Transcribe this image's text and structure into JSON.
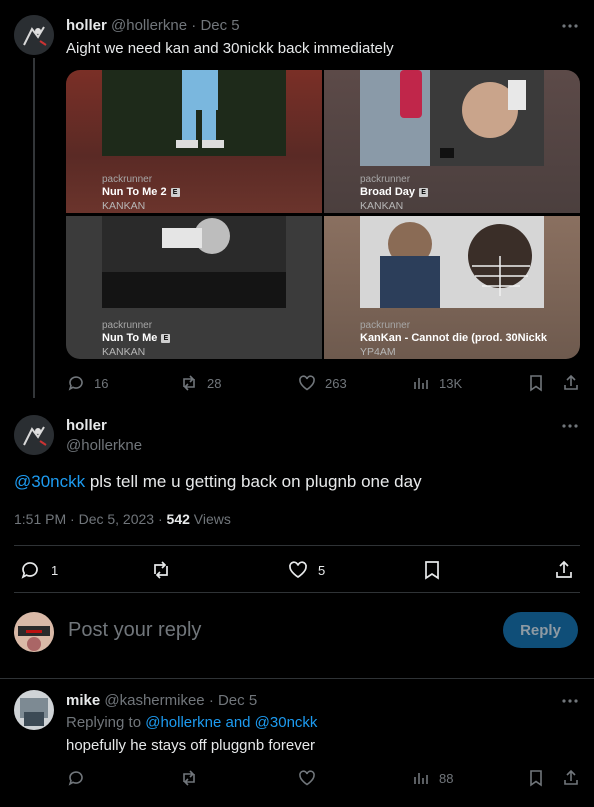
{
  "tweet1": {
    "name": "holler",
    "handle": "@hollerkne",
    "date": "· Dec 5",
    "text": "Aight we need kan and 30nickk back immediately",
    "tiles": [
      {
        "label": "packrunner",
        "title": "Nun To Me 2",
        "artist": "KANKAN"
      },
      {
        "label": "packrunner",
        "title": "Broad Day",
        "artist": "KANKAN"
      },
      {
        "label": "packrunner",
        "title": "Nun To Me",
        "artist": "KANKAN"
      },
      {
        "label": "packrunner",
        "title": "KanKan - Cannot die (prod. 30Nickk",
        "artist": "YP4AM"
      }
    ],
    "stats": {
      "replies": "16",
      "reposts": "28",
      "likes": "263",
      "views": "13K"
    }
  },
  "tweet2": {
    "name": "holler",
    "handle": "@hollerkne",
    "mention": "@30nckk",
    "text": " pls tell me u getting back on plugnb one day",
    "time": "1:51 PM · Dec 5, 2023 · ",
    "views_count": "542",
    "views_label": " Views",
    "stats": {
      "replies": "1",
      "likes": "5"
    }
  },
  "reply_box": {
    "placeholder": "Post your reply",
    "button": "Reply"
  },
  "tweet3": {
    "name": "mike",
    "handle": "@kashermikee",
    "date": "· Dec 5",
    "replying_prefix": "Replying to ",
    "replying_to": "@hollerkne and @30nckk",
    "text": "hopefully he stays off pluggnb forever",
    "stats": {
      "views": "88"
    }
  }
}
